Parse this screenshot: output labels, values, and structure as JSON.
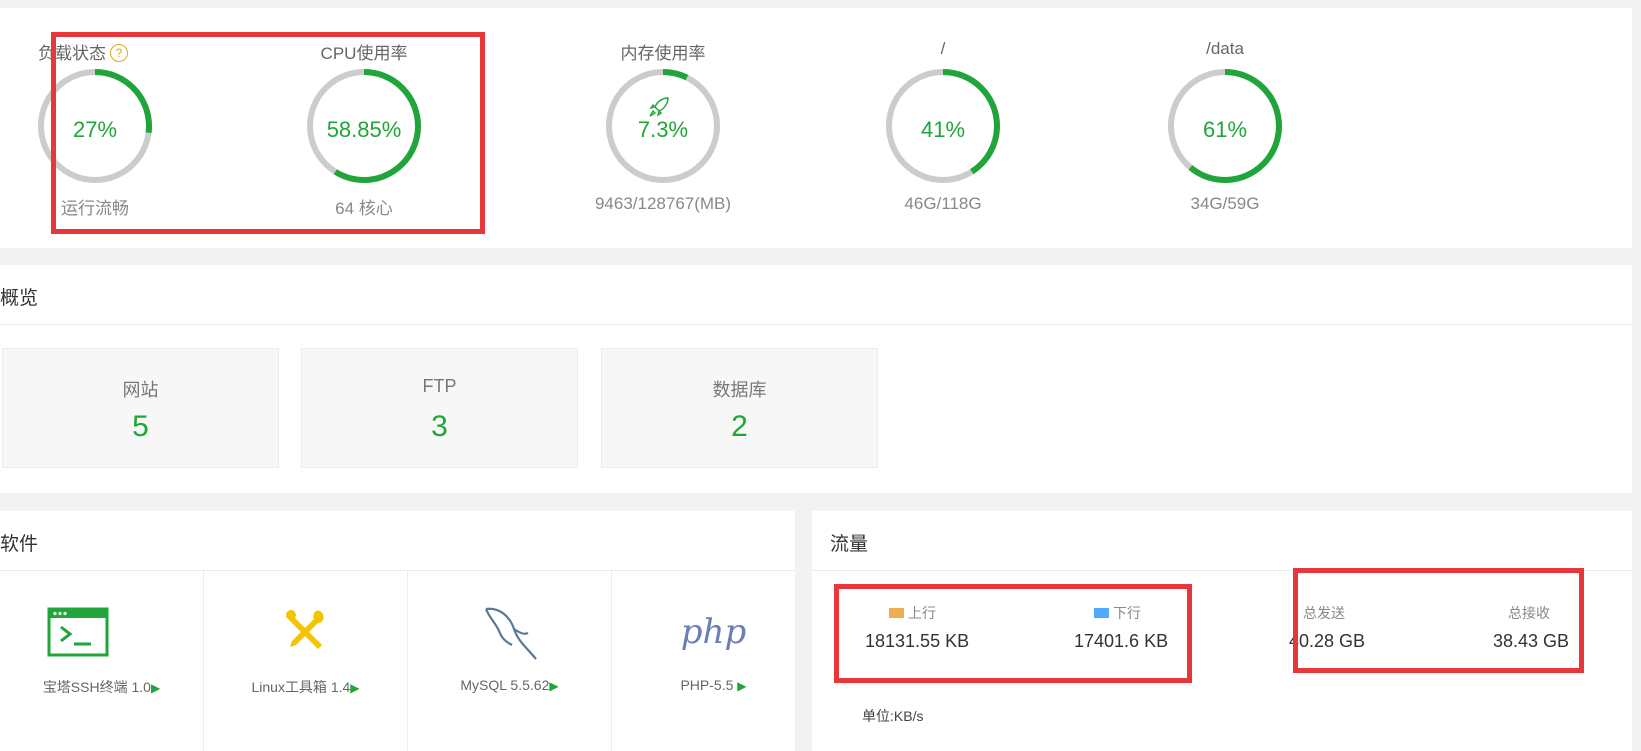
{
  "status": {
    "load": {
      "label": "负载状态",
      "value": "27%",
      "percent": 27,
      "sub": "运行流畅"
    },
    "cpu": {
      "label": "CPU使用率",
      "value": "58.85%",
      "percent": 58.85,
      "sub": "64 核心"
    },
    "memory": {
      "label": "内存使用率",
      "value": "7.3%",
      "percent": 7.3,
      "sub": "9463/128767(MB)"
    },
    "disk_root": {
      "label": "/",
      "value": "41%",
      "percent": 41,
      "sub": "46G/118G"
    },
    "disk_data": {
      "label": "/data",
      "value": "61%",
      "percent": 61,
      "sub": "34G/59G"
    },
    "help_icon": "?",
    "rocket_icon": "rocket-icon"
  },
  "overview": {
    "title": "概览",
    "cards": [
      {
        "label": "网站",
        "count": "5"
      },
      {
        "label": "FTP",
        "count": "3"
      },
      {
        "label": "数据库",
        "count": "2"
      }
    ]
  },
  "software": {
    "title": "软件",
    "items": [
      {
        "name": "宝塔SSH终端 1.0",
        "icon": "terminal-icon"
      },
      {
        "name": "Linux工具箱 1.4",
        "icon": "tools-icon"
      },
      {
        "name": "MySQL 5.5.62",
        "icon": "mysql-dolphin-icon"
      },
      {
        "name": "PHP-5.5",
        "icon": "php-logo",
        "logo_text": "php"
      }
    ],
    "play_glyph": "▶"
  },
  "traffic": {
    "title": "流量",
    "up_label": "上行",
    "up_value": "18131.55 KB",
    "down_label": "下行",
    "down_value": "17401.6 KB",
    "sent_label": "总发送",
    "sent_value": "40.28 GB",
    "recv_label": "总接收",
    "recv_value": "38.43 GB",
    "unit": "单位:KB/s",
    "up_color": "#f0ad4e",
    "down_color": "#52a9ff"
  },
  "colors": {
    "accent": "#20a53a",
    "ring_bg": "#cccccc",
    "highlight": "#e8373a"
  }
}
